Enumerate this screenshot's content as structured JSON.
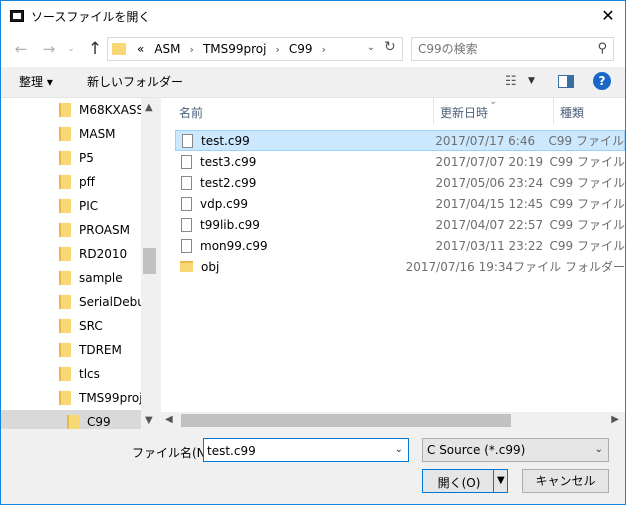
{
  "window": {
    "title": "ソースファイルを開く"
  },
  "address": {
    "crumbs": [
      "«",
      "ASM",
      "TMS99proj",
      "C99"
    ],
    "separator": "›"
  },
  "search": {
    "placeholder": "C99の検索"
  },
  "toolbar": {
    "organize": "整理 ▾",
    "new_folder": "新しいフォルダー"
  },
  "tree": [
    {
      "label": "M68KXASS"
    },
    {
      "label": "MASM"
    },
    {
      "label": "P5"
    },
    {
      "label": "pff"
    },
    {
      "label": "PIC"
    },
    {
      "label": "PROASM"
    },
    {
      "label": "RD2010"
    },
    {
      "label": "sample"
    },
    {
      "label": "SerialDebug"
    },
    {
      "label": "SRC"
    },
    {
      "label": "TDREM"
    },
    {
      "label": "tlcs"
    },
    {
      "label": "TMS99proj"
    },
    {
      "label": "C99",
      "selected": true
    }
  ],
  "columns": {
    "name": "名前",
    "date": "更新日時",
    "type": "種類"
  },
  "files": [
    {
      "name": "test.c99",
      "date": "2017/07/17 6:46",
      "type": "C99 ファイル",
      "kind": "file",
      "selected": true
    },
    {
      "name": "test3.c99",
      "date": "2017/07/07 20:19",
      "type": "C99 ファイル",
      "kind": "file"
    },
    {
      "name": "test2.c99",
      "date": "2017/05/06 23:24",
      "type": "C99 ファイル",
      "kind": "file"
    },
    {
      "name": "vdp.c99",
      "date": "2017/04/15 12:45",
      "type": "C99 ファイル",
      "kind": "file"
    },
    {
      "name": "t99lib.c99",
      "date": "2017/04/07 22:57",
      "type": "C99 ファイル",
      "kind": "file"
    },
    {
      "name": "mon99.c99",
      "date": "2017/03/11 23:22",
      "type": "C99 ファイル",
      "kind": "file"
    },
    {
      "name": "obj",
      "date": "2017/07/16 19:34",
      "type": "ファイル フォルダー",
      "kind": "folder"
    }
  ],
  "footer": {
    "filename_label": "ファイル名(N):",
    "filename_value": "test.c99",
    "filetype": "C Source (*.c99)",
    "open": "開く(O)",
    "cancel": "キャンセル"
  },
  "colors": {
    "accent": "#0078d7",
    "selection": "#cce8ff",
    "folder": "#f8d775"
  }
}
